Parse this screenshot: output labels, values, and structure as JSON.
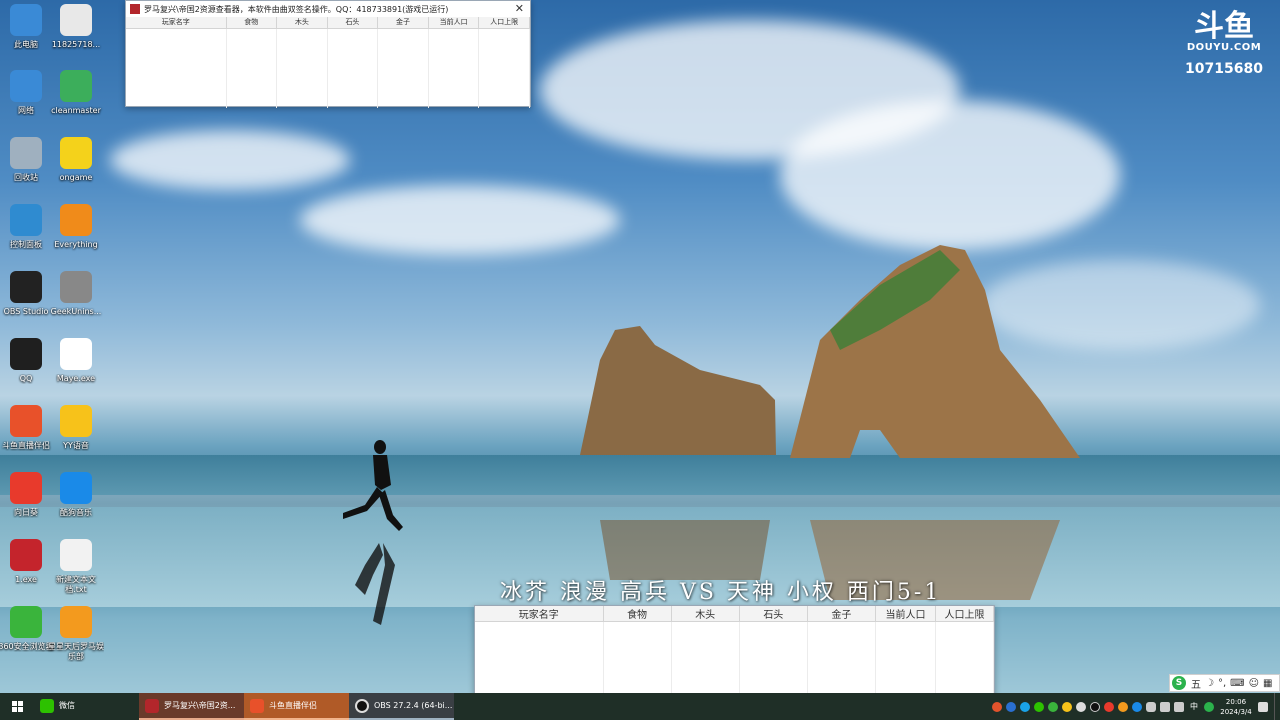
{
  "desktop_icons": [
    {
      "label": "此电脑",
      "icon": "computer-icon",
      "color": "#3a8ad6"
    },
    {
      "label": "11825718...",
      "icon": "document-icon",
      "color": "#e8e8e8"
    },
    {
      "label": "网络",
      "icon": "network-icon",
      "color": "#3a8ad6"
    },
    {
      "label": "cleanmaster",
      "icon": "cleanmaster-icon",
      "color": "#3cae5b"
    },
    {
      "label": "回收站",
      "icon": "recycle-bin-icon",
      "color": "#9fb0bf"
    },
    {
      "label": "ongame",
      "icon": "ongame-icon",
      "color": "#f4d21b"
    },
    {
      "label": "控制面板",
      "icon": "control-panel-icon",
      "color": "#2f8bd0"
    },
    {
      "label": "Everything",
      "icon": "magnifier-icon",
      "color": "#f08b1a"
    },
    {
      "label": "OBS Studio",
      "icon": "obs-icon",
      "color": "#222222"
    },
    {
      "label": "GeekUnins...",
      "icon": "geek-uninstaller-icon",
      "color": "#888888"
    },
    {
      "label": "QQ",
      "icon": "qq-penguin-icon",
      "color": "#1f1f1f"
    },
    {
      "label": "Maye.exe",
      "icon": "maye-icon",
      "color": "#ffffff"
    },
    {
      "label": "斗鱼直播伴侣",
      "icon": "douyu-companion-icon",
      "color": "#e8512a"
    },
    {
      "label": "YY语音",
      "icon": "yy-icon",
      "color": "#f7c21a"
    },
    {
      "label": "向日葵",
      "icon": "sunflower-icon",
      "color": "#e83a2c"
    },
    {
      "label": "酷狗音乐",
      "icon": "kugou-icon",
      "color": "#1a8ae8"
    },
    {
      "label": "1.exe",
      "icon": "exe-icon",
      "color": "#c4242c"
    },
    {
      "label": "新建文本文档.txt",
      "icon": "text-file-icon",
      "color": "#f2f2f2"
    },
    {
      "label": "360安全浏览器",
      "icon": "360-browser-icon",
      "color": "#3ab43c"
    },
    {
      "label": "星星天后罗马娱乐部",
      "icon": "mic-icon",
      "color": "#f39a1e"
    }
  ],
  "resource_window_top": {
    "title": "罗马复兴\\帝国2资源查看器，本软件由曲双签名操作。QQ：418733891(游戏已运行)",
    "columns": [
      "玩家名字",
      "食物",
      "木头",
      "石头",
      "金子",
      "当前人口",
      "人口上限"
    ]
  },
  "resource_window_bottom": {
    "columns": [
      "玩家名字",
      "食物",
      "木头",
      "石头",
      "金子",
      "当前人口",
      "人口上限"
    ]
  },
  "caption": "冰芥 浪漫 高兵 VS 天神 小权 西门5-1",
  "douyu": {
    "brand": "DOUYU.COM",
    "room_id": "10715680"
  },
  "taskbar": {
    "items": [
      {
        "label": "微信",
        "icon": "wechat-icon",
        "color": "#2dc100"
      },
      {
        "label": "罗马复兴\\帝国2资...",
        "icon": "resource-viewer-icon",
        "color": "#b3262b"
      },
      {
        "label": "斗鱼直播伴侣",
        "icon": "douyu-companion-icon",
        "color": "#e8512a"
      },
      {
        "label": "OBS 27.2.4 (64-bi...",
        "icon": "obs-icon",
        "color": "#222222"
      }
    ],
    "ime": "中",
    "time": "20:06",
    "date": "2024/3/4"
  },
  "ime_bar": {
    "mode": "五"
  }
}
